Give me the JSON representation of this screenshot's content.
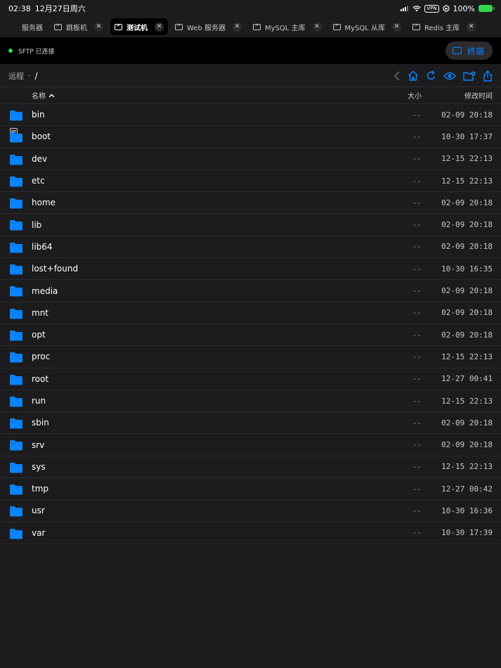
{
  "status_bar": {
    "time": "02:38",
    "date": "12月27日周六",
    "vpn": "VPN",
    "battery": "100%"
  },
  "tabs": [
    {
      "label": "服务器",
      "icon": "server-list-icon",
      "closable": false,
      "active": false
    },
    {
      "label": "跳板机",
      "icon": "terminal-icon",
      "closable": true,
      "active": false
    },
    {
      "label": "测试机",
      "icon": "terminal-icon",
      "closable": true,
      "active": true
    },
    {
      "label": "Web 服务器",
      "icon": "terminal-icon",
      "closable": true,
      "active": false
    },
    {
      "label": "MySQL 主库",
      "icon": "terminal-icon",
      "closable": true,
      "active": false
    },
    {
      "label": "MySQL 从库",
      "icon": "terminal-icon",
      "closable": true,
      "active": false
    },
    {
      "label": "Redis 主库",
      "icon": "terminal-icon",
      "closable": true,
      "active": false
    }
  ],
  "connection": {
    "status": "SFTP 已连接",
    "status_color": "#32d74b",
    "terminal_button": "终端"
  },
  "path": {
    "root_label": "远程",
    "separator": "·",
    "current": "/"
  },
  "toolbar_icons": [
    "back-icon",
    "home-icon",
    "refresh-icon",
    "eye-icon",
    "new-folder-icon",
    "share-icon"
  ],
  "columns": {
    "name": "名称",
    "size": "大小",
    "modified": "修改时间"
  },
  "accent_color": "#0a84ff",
  "files": [
    {
      "name": "bin",
      "size": "--",
      "modified": "02-09 20:18"
    },
    {
      "name": "boot",
      "size": "--",
      "modified": "10-30 17:37"
    },
    {
      "name": "dev",
      "size": "--",
      "modified": "12-15 22:13"
    },
    {
      "name": "etc",
      "size": "--",
      "modified": "12-15 22:13"
    },
    {
      "name": "home",
      "size": "--",
      "modified": "02-09 20:18"
    },
    {
      "name": "lib",
      "size": "--",
      "modified": "02-09 20:18"
    },
    {
      "name": "lib64",
      "size": "--",
      "modified": "02-09 20:18"
    },
    {
      "name": "lost+found",
      "size": "--",
      "modified": "10-30 16:35"
    },
    {
      "name": "media",
      "size": "--",
      "modified": "02-09 20:18"
    },
    {
      "name": "mnt",
      "size": "--",
      "modified": "02-09 20:18"
    },
    {
      "name": "opt",
      "size": "--",
      "modified": "02-09 20:18"
    },
    {
      "name": "proc",
      "size": "--",
      "modified": "12-15 22:13"
    },
    {
      "name": "root",
      "size": "--",
      "modified": "12-27 00:41"
    },
    {
      "name": "run",
      "size": "--",
      "modified": "12-15 22:13"
    },
    {
      "name": "sbin",
      "size": "--",
      "modified": "02-09 20:18"
    },
    {
      "name": "srv",
      "size": "--",
      "modified": "02-09 20:18"
    },
    {
      "name": "sys",
      "size": "--",
      "modified": "12-15 22:13"
    },
    {
      "name": "tmp",
      "size": "--",
      "modified": "12-27 00:42"
    },
    {
      "name": "usr",
      "size": "--",
      "modified": "10-30 16:36"
    },
    {
      "name": "var",
      "size": "--",
      "modified": "10-30 17:39"
    }
  ]
}
